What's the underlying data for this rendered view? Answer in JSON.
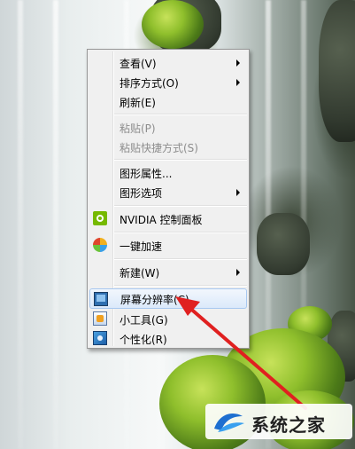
{
  "context_menu": {
    "items": [
      {
        "label": "查看(V)",
        "has_submenu": true,
        "disabled": false
      },
      {
        "label": "排序方式(O)",
        "has_submenu": true,
        "disabled": false
      },
      {
        "label": "刷新(E)",
        "has_submenu": false,
        "disabled": false
      },
      {
        "label": "粘贴(P)",
        "has_submenu": false,
        "disabled": true
      },
      {
        "label": "粘贴快捷方式(S)",
        "has_submenu": false,
        "disabled": true
      },
      {
        "label": "图形属性...",
        "has_submenu": false,
        "disabled": false
      },
      {
        "label": "图形选项",
        "has_submenu": true,
        "disabled": false
      },
      {
        "label": "NVIDIA 控制面板",
        "has_submenu": false,
        "disabled": false,
        "icon": "nvidia-icon"
      },
      {
        "label": "一键加速",
        "has_submenu": false,
        "disabled": false,
        "icon": "accelerate-icon"
      },
      {
        "label": "新建(W)",
        "has_submenu": true,
        "disabled": false
      },
      {
        "label": "屏幕分辨率(C)",
        "has_submenu": false,
        "disabled": false,
        "highlighted": true,
        "icon": "screen-resolution-icon"
      },
      {
        "label": "小工具(G)",
        "has_submenu": false,
        "disabled": false,
        "icon": "gadgets-icon"
      },
      {
        "label": "个性化(R)",
        "has_submenu": false,
        "disabled": false,
        "icon": "personalize-icon"
      }
    ]
  },
  "watermark": {
    "text": "系统之家"
  },
  "colors": {
    "highlight_border": "#a8c8f0",
    "arrow": "#e02020",
    "menu_bg": "#f0f0f0"
  }
}
